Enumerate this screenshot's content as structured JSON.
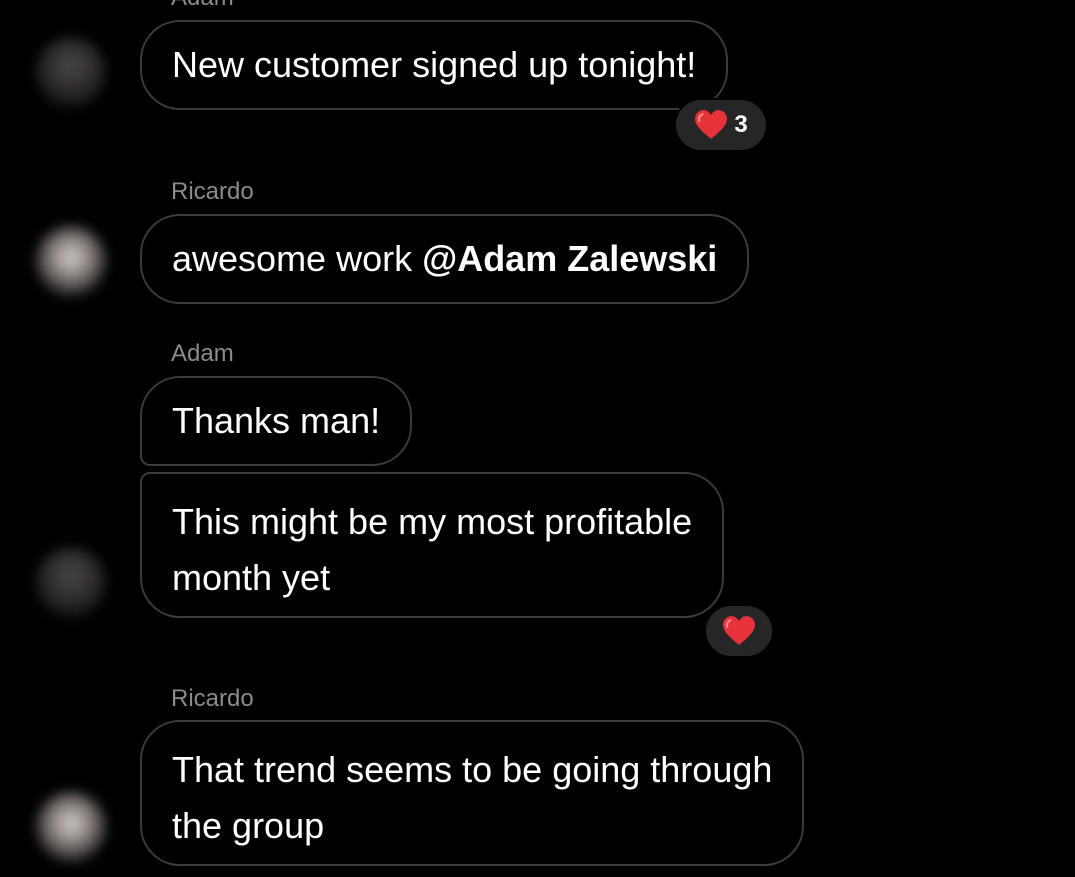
{
  "messages": [
    {
      "sender": "Adam",
      "text": "New customer signed up tonight!",
      "reaction": {
        "emoji": "heart",
        "count": "3"
      }
    },
    {
      "sender": "Ricardo",
      "text_prefix": "awesome work ",
      "mention": "@Adam Zalewski"
    },
    {
      "sender": "Adam",
      "text": "Thanks man!"
    },
    {
      "sender": "Adam",
      "lines": [
        "This might be my most profitable",
        "month yet"
      ],
      "reaction": {
        "emoji": "heart"
      }
    },
    {
      "sender": "Ricardo",
      "lines": [
        "That trend seems to be going through",
        "the group"
      ]
    }
  ],
  "colors": {
    "background": "#000000",
    "bubble_border": "#3b3b3b",
    "sender_text": "#8b8b8b",
    "reaction_bg": "#262626",
    "heart": "#e8323a"
  }
}
